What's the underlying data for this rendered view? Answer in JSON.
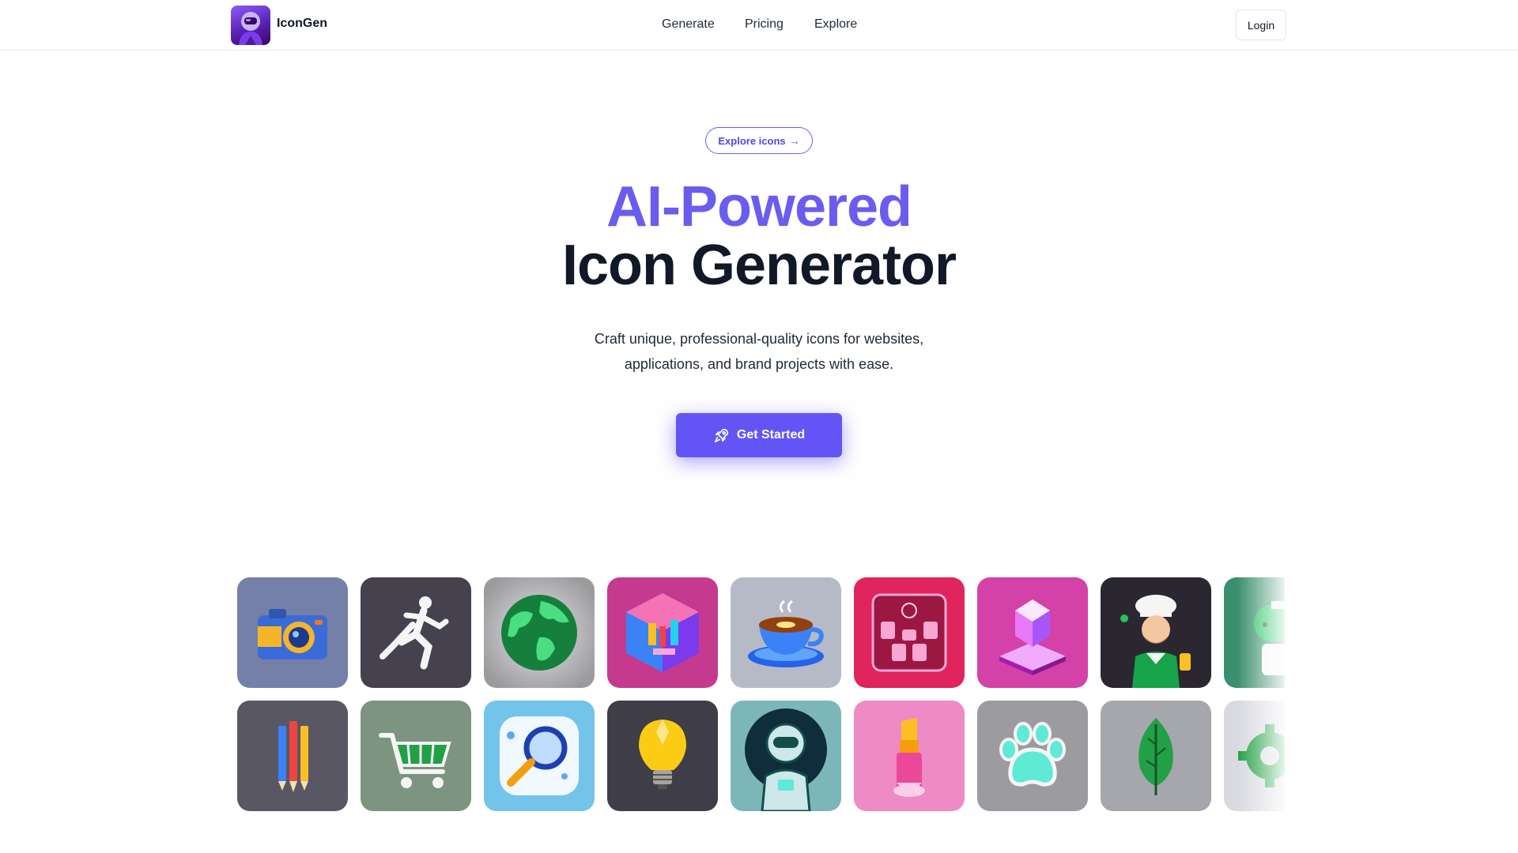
{
  "header": {
    "brand_name": "IconGen",
    "logo_icon": "astronaut-logo-icon",
    "nav_links": [
      "Generate",
      "Pricing",
      "Explore"
    ],
    "login_label": "Login"
  },
  "hero": {
    "badge_label": "Explore icons",
    "badge_arrow": "→",
    "title_accent": "AI-Powered",
    "title_main": "Icon Generator",
    "subtitle_line1": "Craft unique, professional-quality icons for websites,",
    "subtitle_line2": "applications, and brand projects with ease.",
    "cta_label": "Get Started",
    "cta_icon": "rocket-icon"
  },
  "colors": {
    "accent": "#6b5cf0",
    "cta_background": "#6355f5",
    "text_primary": "#111827",
    "border": "#e5e7eb"
  },
  "gallery": {
    "row1": [
      "camera-icon",
      "runner-icon",
      "globe-icon",
      "isometric-room-icon",
      "coffee-cup-icon",
      "sports-team-icon",
      "crystal-pedestal-icon",
      "chef-icon",
      "doctor-icon"
    ],
    "row2": [
      "pencils-icon",
      "shopping-cart-icon",
      "magnifier-icon",
      "lightbulb-icon",
      "astronaut-icon",
      "lipstick-icon",
      "paw-print-icon",
      "leaf-icon",
      "gear-icon"
    ]
  }
}
